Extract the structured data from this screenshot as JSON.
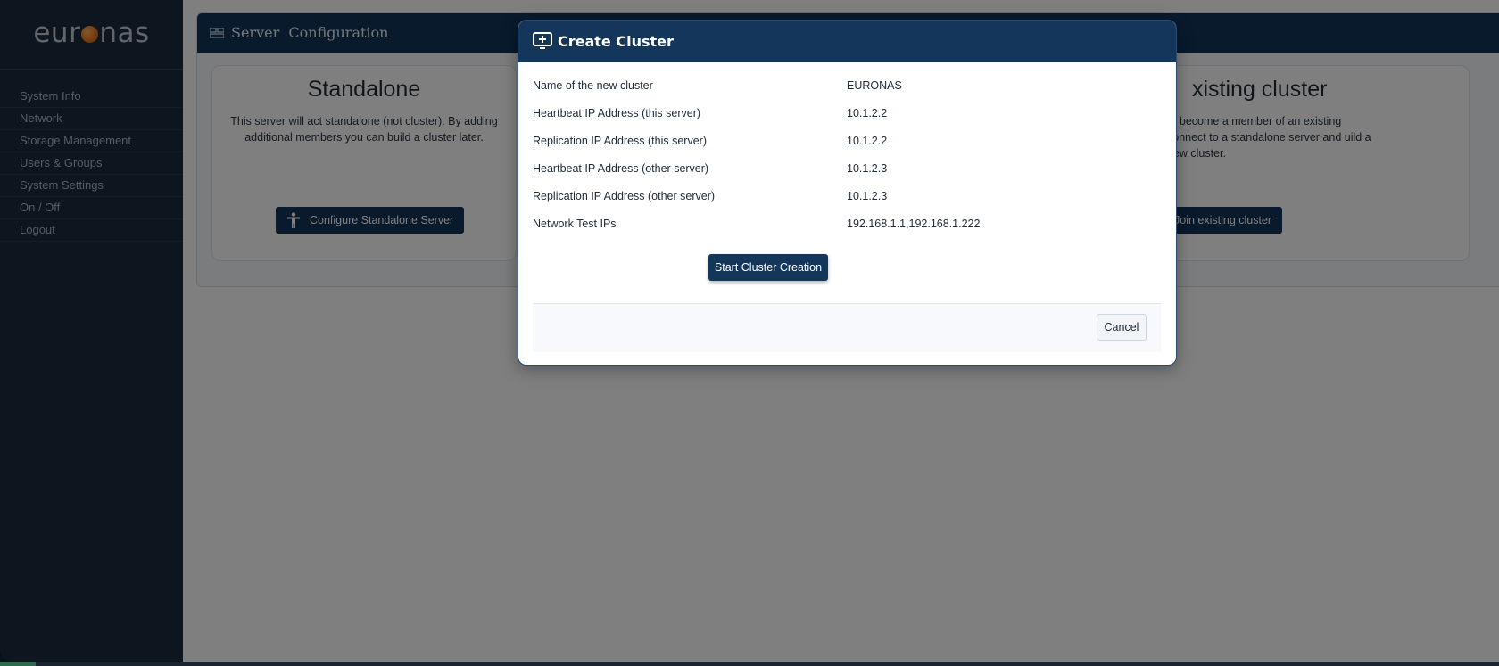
{
  "brand": {
    "logo_left": "eur",
    "logo_right": "nas",
    "accent": "#f07a1c"
  },
  "sidebar": {
    "items": [
      {
        "label": "System Info"
      },
      {
        "label": "Network"
      },
      {
        "label": "Storage Management"
      },
      {
        "label": "Users & Groups"
      },
      {
        "label": "System Settings"
      },
      {
        "label": "On / Off"
      },
      {
        "label": "Logout"
      }
    ]
  },
  "page": {
    "title": "Server  Configuration",
    "title_icon": "server-config-icon"
  },
  "cards": {
    "standalone": {
      "title": "Standalone",
      "text": "This server will act standalone (not cluster). By adding additional members you can build a cluster later.",
      "button": "Configure Standalone Server"
    },
    "join": {
      "title": "xisting cluster",
      "text": "to become a member of an existing connect to a standalone server and uild a new cluster.",
      "button": "Join existing cluster"
    }
  },
  "modal": {
    "title": "Create Cluster",
    "title_icon": "add-monitor-icon",
    "fields": [
      {
        "label": "Name of the new cluster",
        "value": "EURONAS"
      },
      {
        "label": "Heartbeat IP Address (this server)",
        "value": "10.1.2.2"
      },
      {
        "label": "Replication IP Address (this server)",
        "value": "10.1.2.2"
      },
      {
        "label": "Heartbeat IP Address (other server)",
        "value": "10.1.2.3"
      },
      {
        "label": "Replication IP Address (other server)",
        "value": "10.1.2.3"
      },
      {
        "label": "Network Test IPs",
        "value": "192.168.1.1,192.168.1.222"
      }
    ],
    "start_button": "Start Cluster Creation",
    "cancel_button": "Cancel"
  }
}
